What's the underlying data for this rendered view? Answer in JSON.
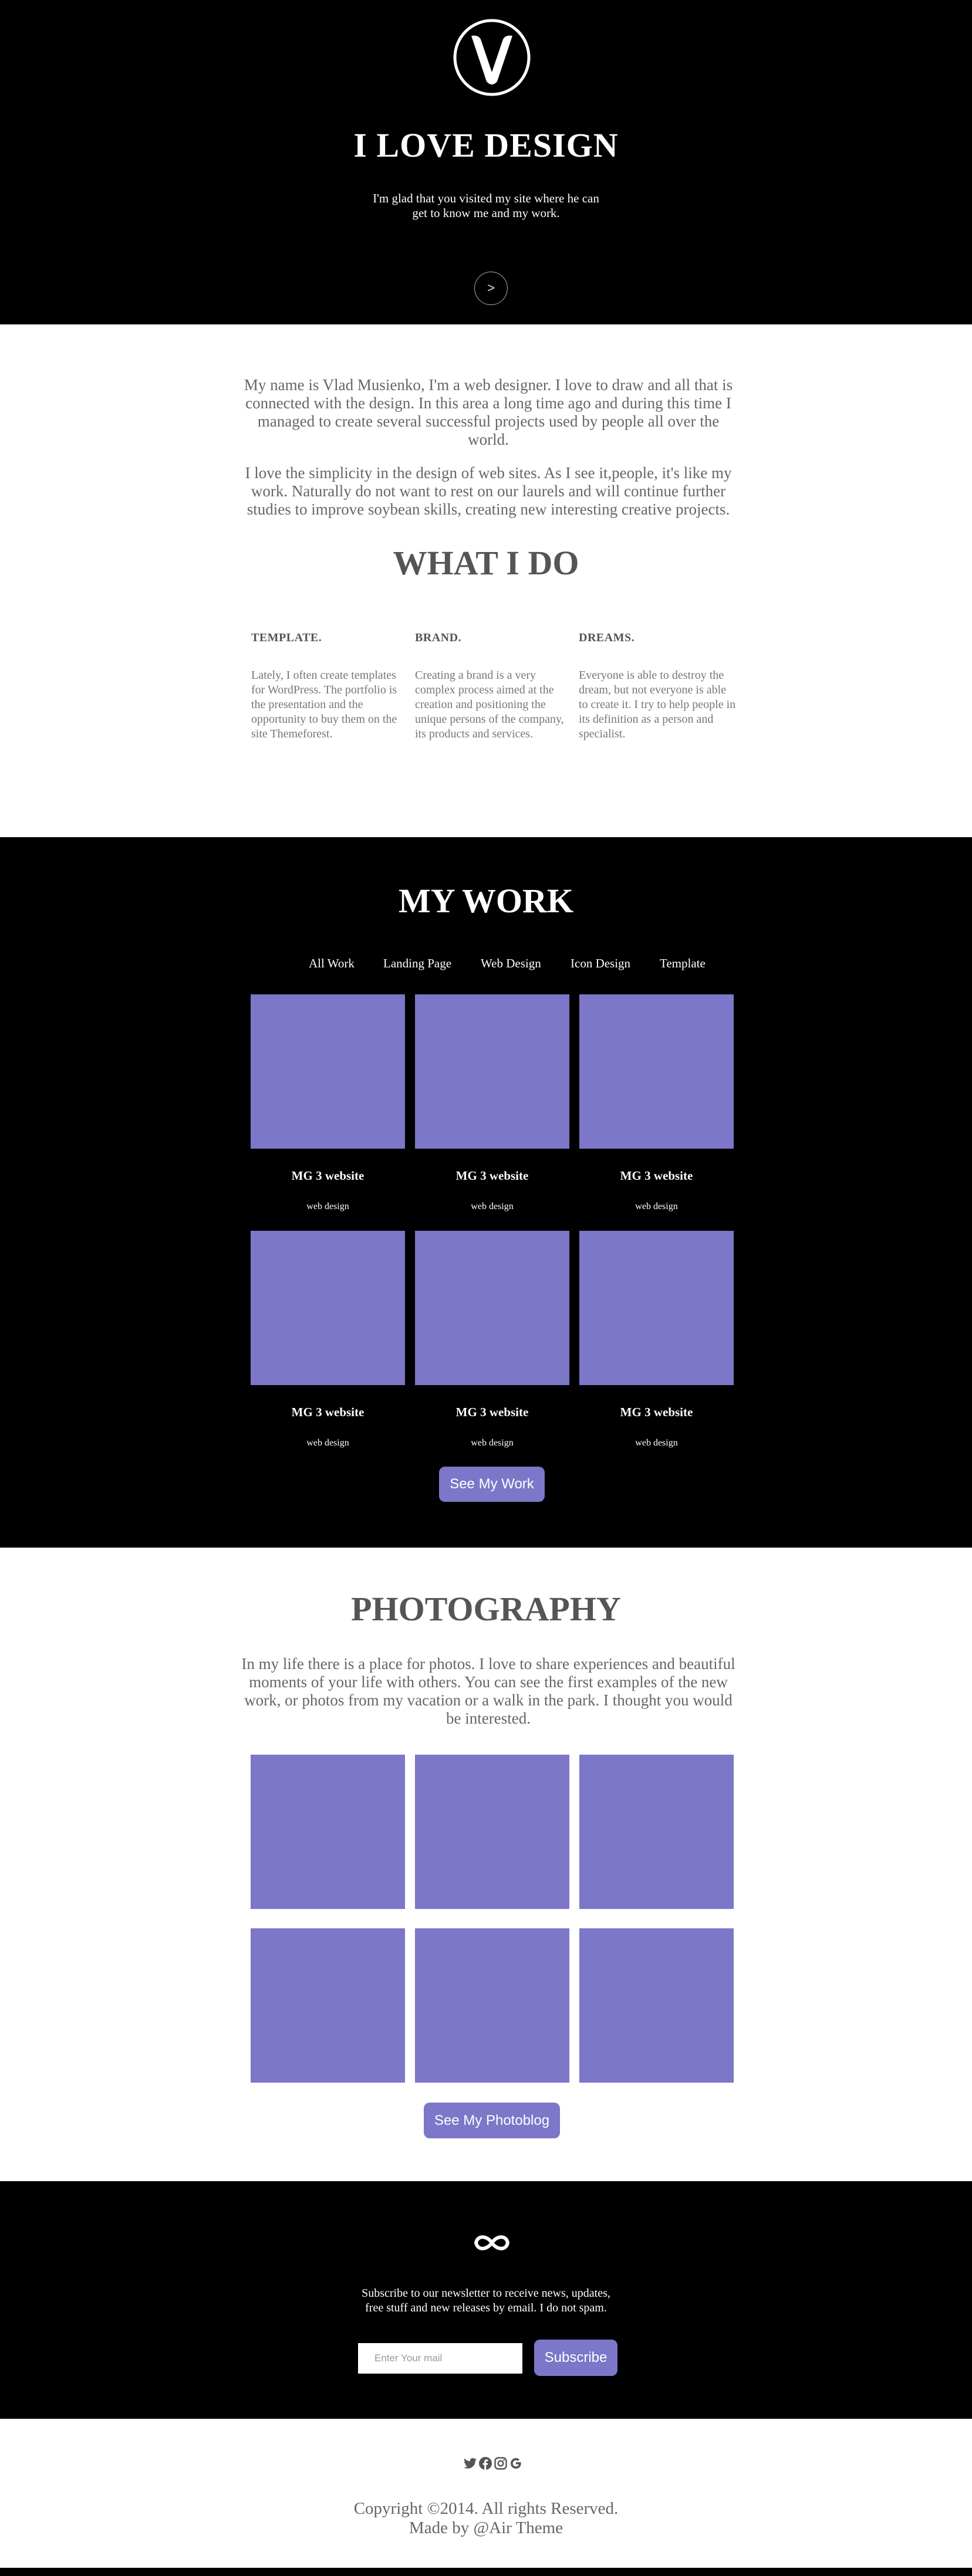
{
  "hero": {
    "title": "I LOVE DESIGN",
    "subtitle": "I'm glad that you visited my site where he can get to know me and my work.",
    "scroll_label": ">",
    "logo_icon": "v-circle-logo"
  },
  "about": {
    "p1": "My name is Vlad Musienko, I'm a web designer. I love to draw and all that is connected with the design. In this area a long time ago and during this time I managed to create several successful projects used by people all over the world.",
    "p2": "I love the simplicity in the design of web sites. As I see it,people, it's like my work. Naturally do not want to rest on our laurels and will continue further studies to improve soybean skills, creating new interesting creative projects."
  },
  "what_i_do": {
    "title": "WHAT I DO",
    "services": [
      {
        "title": "TEMPLATE.",
        "text": "Lately, I often create templates for WordPress. The portfolio is the presentation and the opportunity to buy them on the site Themeforest."
      },
      {
        "title": "BRAND.",
        "text": "Creating a brand is a very complex process aimed at the creation and positioning the unique persons of the company, its products and services."
      },
      {
        "title": "DREAMS.",
        "text": "Everyone is able to destroy the dream, but not everyone is able to create it. I try to help people in its definition as a person and specialist."
      }
    ]
  },
  "work": {
    "title": "MY WORK",
    "filters": [
      "All Work",
      "Landing Page",
      "Web Design",
      "Icon Design",
      "Template"
    ],
    "items": [
      {
        "name": "MG 3 website",
        "category": "web design"
      },
      {
        "name": "MG 3 website",
        "category": "web design"
      },
      {
        "name": "MG 3 website",
        "category": "web design"
      },
      {
        "name": "MG 3 website",
        "category": "web design"
      },
      {
        "name": "MG 3 website",
        "category": "web design"
      },
      {
        "name": "MG 3 website",
        "category": "web design"
      }
    ],
    "button": "See My Work",
    "thumb_color": "#7c77c8"
  },
  "photography": {
    "title": "PHOTOGRAPHY",
    "text": "In my life there is a place for photos. I love to share experiences and beautiful moments of your life with others. You can see the first examples of the new work, or photos from my vacation or a walk in the park. I thought you would be interested.",
    "button": "See My Photoblog"
  },
  "newsletter": {
    "icon": "infinity-icon",
    "text": "Subscribe to our newsletter to receive news, updates, free stuff and new releases by email. I do not spam.",
    "placeholder": "Enter Your mail",
    "button": "Subscribe"
  },
  "footer": {
    "social_icons": [
      "twitter-icon",
      "facebook-icon",
      "instagram-icon",
      "google-icon"
    ],
    "copyright": "Copyright ©2014. All rights Reserved.",
    "credit": "Made by @Air Theme"
  },
  "colors": {
    "accent": "#7c77c8",
    "dark": "#000000",
    "text": "#555555"
  }
}
